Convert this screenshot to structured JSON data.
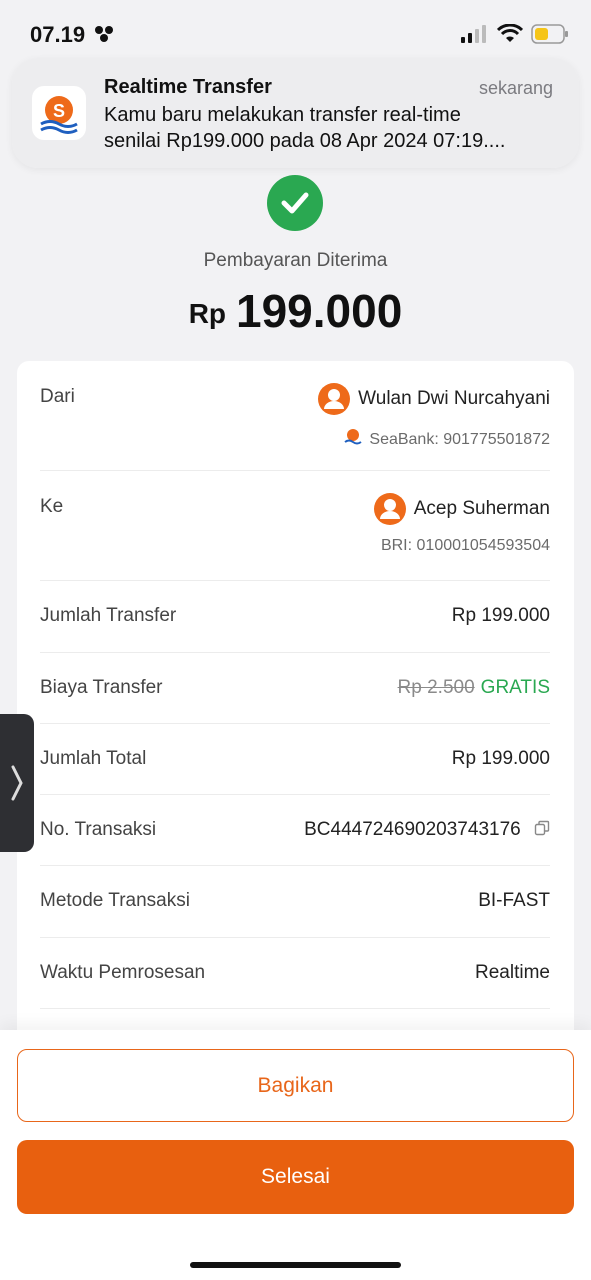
{
  "status_bar": {
    "time": "07.19"
  },
  "notification": {
    "title": "Realtime Transfer",
    "time": "sekarang",
    "body_line1": "Kamu baru melakukan transfer real-time",
    "body_line2": "senilai Rp199.000 pada 08 Apr 2024 07:19...."
  },
  "receipt": {
    "status_label": "Pembayaran Diterima",
    "currency": "Rp",
    "amount": "199.000"
  },
  "details": {
    "from_label": "Dari",
    "from_name": "Wulan Dwi Nurcahyani",
    "from_account": "SeaBank: 901775501872",
    "to_label": "Ke",
    "to_name": "Acep Suherman",
    "to_account": "BRI: 010001054593504",
    "amount_label": "Jumlah Transfer",
    "amount_value": "Rp 199.000",
    "fee_label": "Biaya Transfer",
    "fee_original": "Rp 2.500",
    "fee_value": "GRATIS",
    "total_label": "Jumlah Total",
    "total_value": "Rp 199.000",
    "txn_label": "No. Transaksi",
    "txn_value": "BC444724690203743176",
    "method_label": "Metode Transaksi",
    "method_value": "BI-FAST",
    "processing_label": "Waktu Pemrosesan",
    "processing_value": "Realtime"
  },
  "actions": {
    "share_label": "Bagikan",
    "done_label": "Selesai"
  },
  "colors": {
    "accent": "#e8600f",
    "success": "#2aa851"
  }
}
